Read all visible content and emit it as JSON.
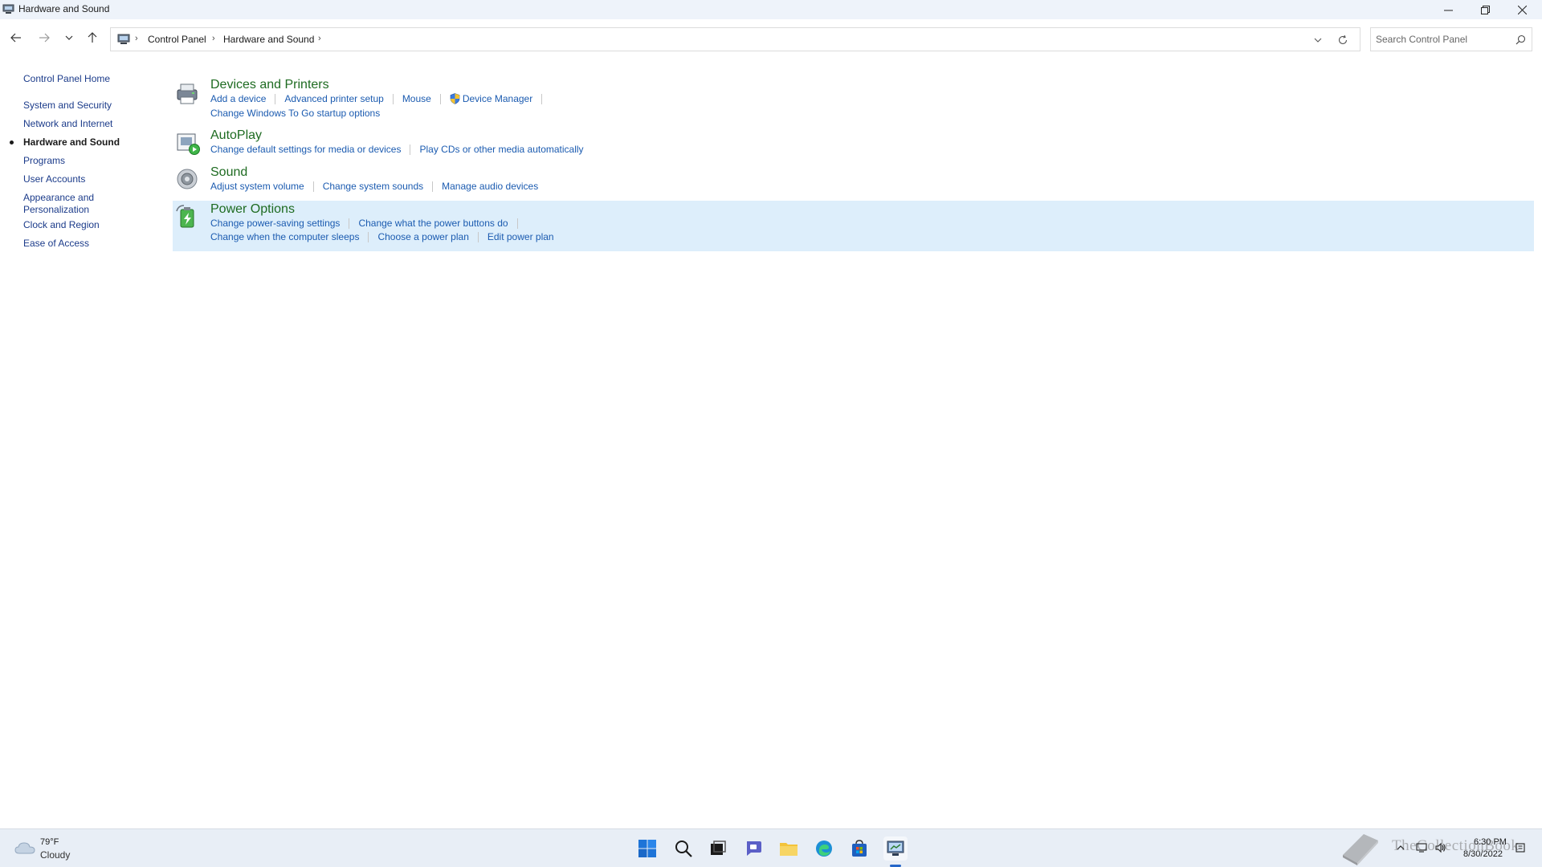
{
  "window": {
    "title": "Hardware and Sound"
  },
  "address": {
    "crumbs": [
      "Control Panel",
      "Hardware and Sound"
    ],
    "sep": "›"
  },
  "search": {
    "placeholder": "Search Control Panel"
  },
  "sidebar": {
    "items": [
      {
        "label": "Control Panel Home"
      },
      {
        "label": "System and Security"
      },
      {
        "label": "Network and Internet"
      },
      {
        "label": "Hardware and Sound",
        "active": true
      },
      {
        "label": "Programs"
      },
      {
        "label": "User Accounts"
      },
      {
        "label": "Appearance and",
        "label2": "Personalization"
      },
      {
        "label": "Clock and Region"
      },
      {
        "label": "Ease of Access"
      }
    ]
  },
  "categories": [
    {
      "title": "Devices and Printers",
      "icon": "printer-icon",
      "rows": [
        [
          "Add a device",
          "Advanced printer setup",
          "Mouse",
          "Device Manager"
        ],
        [
          "Change Windows To Go startup options"
        ]
      ]
    },
    {
      "title": "AutoPlay",
      "icon": "autoplay-icon",
      "rows": [
        [
          "Change default settings for media or devices",
          "Play CDs or other media automatically"
        ]
      ]
    },
    {
      "title": "Sound",
      "icon": "speaker-icon",
      "rows": [
        [
          "Adjust system volume",
          "Change system sounds",
          "Manage audio devices"
        ]
      ]
    },
    {
      "title": "Power Options",
      "icon": "battery-icon",
      "highlighted": true,
      "rows": [
        [
          "Change power-saving settings",
          "Change what the power buttons do"
        ],
        [
          "Change when the computer sleeps",
          "Choose a power plan",
          "Edit power plan"
        ]
      ]
    }
  ],
  "taskbar": {
    "weather": {
      "temp": "79°F",
      "condition": "Cloudy",
      "icon": "cloud-icon"
    },
    "apps": [
      "windows-start-icon",
      "search-icon",
      "task-view-icon",
      "chat-icon",
      "file-explorer-icon",
      "edge-icon",
      "store-icon",
      "control-panel-icon"
    ],
    "clock": {
      "time": "6:30 PM",
      "date": "8/30/2022"
    },
    "watermark": "TheCollectionBook"
  },
  "colors": {
    "category_title": "#1e6b21",
    "link": "#1b5bb0",
    "nav_link": "#1b3b8a",
    "highlight": "#ddeefb",
    "taskbar": "#e8eef6"
  }
}
